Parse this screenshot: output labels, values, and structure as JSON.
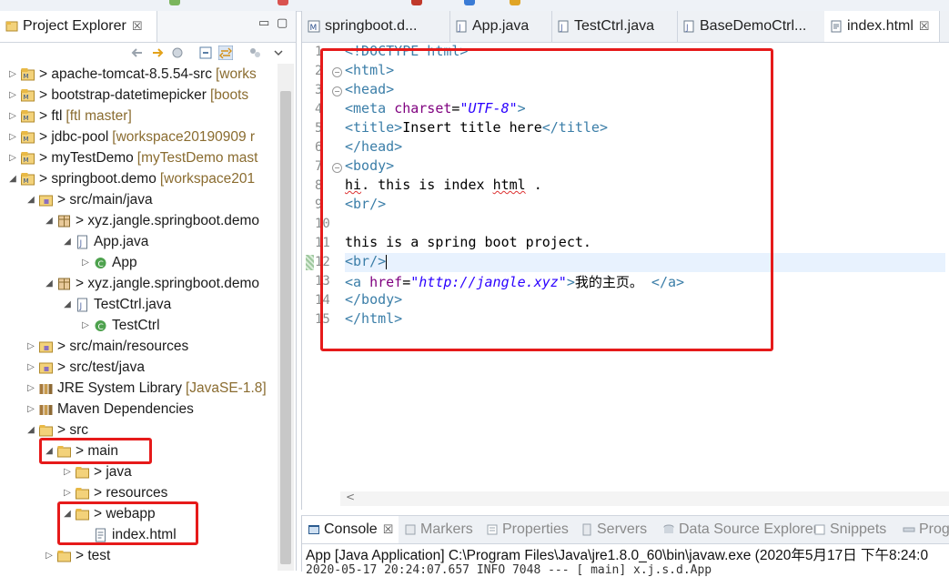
{
  "project_explorer": {
    "title": "Project Explorer",
    "close": "☒",
    "rows": [
      {
        "label": "> apache-tomcat-8.5.54-src",
        "deco": "[works",
        "icon": "project-icon"
      },
      {
        "label": "> bootstrap-datetimepicker",
        "deco": "[boots",
        "icon": "project-icon"
      },
      {
        "label": "> ftl",
        "deco": "[ftl master]",
        "icon": "project-icon"
      },
      {
        "label": "> jdbc-pool",
        "deco": "[workspace20190909 r",
        "icon": "project-icon"
      },
      {
        "label": "> myTestDemo",
        "deco": "[myTestDemo mast",
        "icon": "project-icon"
      },
      {
        "label": "> springboot.demo",
        "deco": "[workspace201",
        "icon": "project-icon"
      },
      {
        "label": "> src/main/java",
        "deco": "",
        "icon": "source-folder-icon"
      },
      {
        "label": "> xyz.jangle.springboot.demo",
        "deco": "",
        "icon": "package-icon"
      },
      {
        "label": "App.java",
        "deco": "",
        "icon": "java-file-icon"
      },
      {
        "label": "App",
        "deco": "",
        "icon": "class-icon"
      },
      {
        "label": "> xyz.jangle.springboot.demo",
        "deco": "",
        "icon": "package-icon"
      },
      {
        "label": "TestCtrl.java",
        "deco": "",
        "icon": "java-file-icon"
      },
      {
        "label": "TestCtrl",
        "deco": "",
        "icon": "class-icon"
      },
      {
        "label": "> src/main/resources",
        "deco": "",
        "icon": "source-folder-icon"
      },
      {
        "label": "> src/test/java",
        "deco": "",
        "icon": "source-folder-icon"
      },
      {
        "label": "JRE System Library",
        "deco": "[JavaSE-1.8]",
        "icon": "library-icon"
      },
      {
        "label": "Maven Dependencies",
        "deco": "",
        "icon": "library-icon"
      },
      {
        "label": "> src",
        "deco": "",
        "icon": "folder-icon"
      },
      {
        "label": "> main",
        "deco": "",
        "icon": "folder-icon"
      },
      {
        "label": "> java",
        "deco": "",
        "icon": "folder-icon"
      },
      {
        "label": "> resources",
        "deco": "",
        "icon": "folder-icon"
      },
      {
        "label": "> webapp",
        "deco": "",
        "icon": "folder-icon"
      },
      {
        "label": "index.html",
        "deco": "",
        "icon": "html-file-icon"
      },
      {
        "label": "> test",
        "deco": "",
        "icon": "folder-icon"
      }
    ]
  },
  "editor": {
    "tabs": [
      "springboot.d...",
      "App.java",
      "TestCtrl.java",
      "BaseDemoCtrl...",
      "index.html"
    ],
    "active_tab_close": "☒",
    "line_numbers": [
      "1",
      "2",
      "3",
      "4",
      "5",
      "6",
      "7",
      "8",
      "9",
      "10",
      "11",
      "12",
      "13",
      "14",
      "15"
    ],
    "lines": {
      "l1": "<!DOCTYPE html>",
      "l2": "<html>",
      "l3": "<head>",
      "l4_tag": "<meta ",
      "l4_attr": "charset",
      "l4_eq": "=",
      "l4_val": "\"UTF-8\"",
      "l4_close": ">",
      "l5_open": "<title>",
      "l5_text": "Insert title here",
      "l5_close": "</title>",
      "l6": "</head>",
      "l7": "<body>",
      "l8_a": "hi",
      "l8_b": ". this is index ",
      "l8_c": "html",
      "l8_d": " .",
      "l9": "<br/>",
      "l11": "this is a spring boot project.",
      "l12": "<br/>",
      "l13_tag": "<a ",
      "l13_attr": "href",
      "l13_eq": "=",
      "l13_val": "\"http://jangle.xyz\"",
      "l13_gt": ">",
      "l13_text": "我的主页。",
      "l13_close": " </a>",
      "l14": "</body>",
      "l15": "</html>"
    }
  },
  "console": {
    "tabs": [
      "Console",
      "Markers",
      "Properties",
      "Servers",
      "Data Source Explorer",
      "Snippets",
      "Prog"
    ],
    "description": "App [Java Application] C:\\Program Files\\Java\\jre1.8.0_60\\bin\\javaw.exe (2020年5月17日 下午8:24:0",
    "log_line": "2020-05-17 20:24:07.657  INFO 7048 --- [           main] x.j.s.d.App"
  },
  "colors": {
    "annotation": "#e61a1a",
    "tag": "#3b7ea8",
    "attribute": "#7f007f",
    "string": "#2a00ff"
  }
}
